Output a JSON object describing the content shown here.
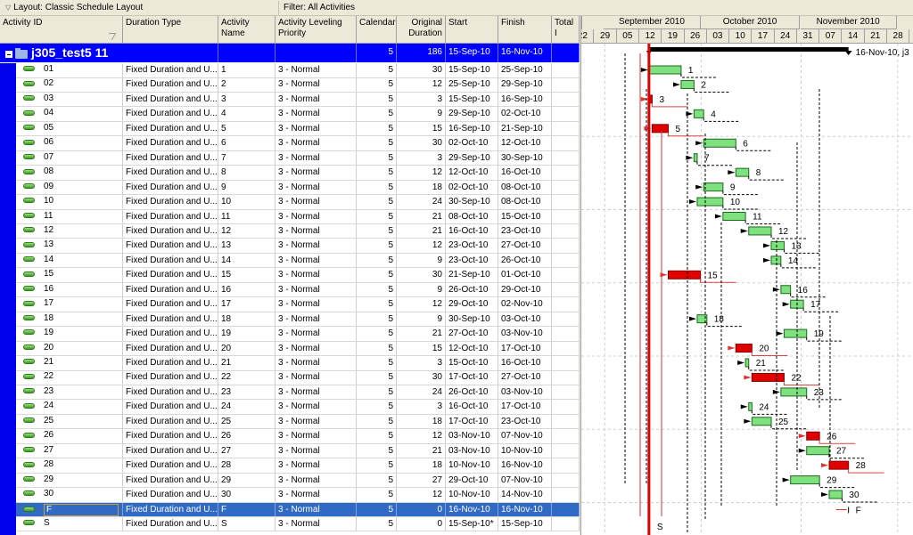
{
  "toolbar": {
    "layout_label": "Layout: Classic Schedule Layout",
    "filter_label": "Filter: All Activities"
  },
  "columns": [
    {
      "key": "id",
      "label": "Activity ID"
    },
    {
      "key": "duration_type",
      "label": "Duration Type"
    },
    {
      "key": "name",
      "label": "Activity Name"
    },
    {
      "key": "priority",
      "label": "Activity Leveling Priority"
    },
    {
      "key": "calendar",
      "label": "Calendar"
    },
    {
      "key": "orig_duration",
      "label": "Original Duration"
    },
    {
      "key": "start",
      "label": "Start"
    },
    {
      "key": "finish",
      "label": "Finish"
    },
    {
      "key": "total_float",
      "label": "Total I"
    }
  ],
  "group": {
    "title": "j305_test5  11",
    "calendar": "5",
    "orig_duration": "186",
    "start": "15-Sep-10",
    "finish": "16-Nov-10"
  },
  "activities": [
    {
      "id": "01",
      "duration_type": "Fixed Duration and U...",
      "name": "1",
      "priority": "3 - Normal",
      "calendar": "5",
      "orig_duration": "30",
      "start": "15-Sep-10",
      "finish": "25-Sep-10",
      "critical": false
    },
    {
      "id": "02",
      "duration_type": "Fixed Duration and U...",
      "name": "2",
      "priority": "3 - Normal",
      "calendar": "5",
      "orig_duration": "12",
      "start": "25-Sep-10",
      "finish": "29-Sep-10",
      "critical": false
    },
    {
      "id": "03",
      "duration_type": "Fixed Duration and U...",
      "name": "3",
      "priority": "3 - Normal",
      "calendar": "5",
      "orig_duration": "3",
      "start": "15-Sep-10",
      "finish": "16-Sep-10",
      "critical": true
    },
    {
      "id": "04",
      "duration_type": "Fixed Duration and U...",
      "name": "4",
      "priority": "3 - Normal",
      "calendar": "5",
      "orig_duration": "9",
      "start": "29-Sep-10",
      "finish": "02-Oct-10",
      "critical": false
    },
    {
      "id": "05",
      "duration_type": "Fixed Duration and U...",
      "name": "5",
      "priority": "3 - Normal",
      "calendar": "5",
      "orig_duration": "15",
      "start": "16-Sep-10",
      "finish": "21-Sep-10",
      "critical": true
    },
    {
      "id": "06",
      "duration_type": "Fixed Duration and U...",
      "name": "6",
      "priority": "3 - Normal",
      "calendar": "5",
      "orig_duration": "30",
      "start": "02-Oct-10",
      "finish": "12-Oct-10",
      "critical": false
    },
    {
      "id": "07",
      "duration_type": "Fixed Duration and U...",
      "name": "7",
      "priority": "3 - Normal",
      "calendar": "5",
      "orig_duration": "3",
      "start": "29-Sep-10",
      "finish": "30-Sep-10",
      "critical": false
    },
    {
      "id": "08",
      "duration_type": "Fixed Duration and U...",
      "name": "8",
      "priority": "3 - Normal",
      "calendar": "5",
      "orig_duration": "12",
      "start": "12-Oct-10",
      "finish": "16-Oct-10",
      "critical": false
    },
    {
      "id": "09",
      "duration_type": "Fixed Duration and U...",
      "name": "9",
      "priority": "3 - Normal",
      "calendar": "5",
      "orig_duration": "18",
      "start": "02-Oct-10",
      "finish": "08-Oct-10",
      "critical": false
    },
    {
      "id": "10",
      "duration_type": "Fixed Duration and U...",
      "name": "10",
      "priority": "3 - Normal",
      "calendar": "5",
      "orig_duration": "24",
      "start": "30-Sep-10",
      "finish": "08-Oct-10",
      "critical": false
    },
    {
      "id": "11",
      "duration_type": "Fixed Duration and U...",
      "name": "11",
      "priority": "3 - Normal",
      "calendar": "5",
      "orig_duration": "21",
      "start": "08-Oct-10",
      "finish": "15-Oct-10",
      "critical": false
    },
    {
      "id": "12",
      "duration_type": "Fixed Duration and U...",
      "name": "12",
      "priority": "3 - Normal",
      "calendar": "5",
      "orig_duration": "21",
      "start": "16-Oct-10",
      "finish": "23-Oct-10",
      "critical": false
    },
    {
      "id": "13",
      "duration_type": "Fixed Duration and U...",
      "name": "13",
      "priority": "3 - Normal",
      "calendar": "5",
      "orig_duration": "12",
      "start": "23-Oct-10",
      "finish": "27-Oct-10",
      "critical": false
    },
    {
      "id": "14",
      "duration_type": "Fixed Duration and U...",
      "name": "14",
      "priority": "3 - Normal",
      "calendar": "5",
      "orig_duration": "9",
      "start": "23-Oct-10",
      "finish": "26-Oct-10",
      "critical": false
    },
    {
      "id": "15",
      "duration_type": "Fixed Duration and U...",
      "name": "15",
      "priority": "3 - Normal",
      "calendar": "5",
      "orig_duration": "30",
      "start": "21-Sep-10",
      "finish": "01-Oct-10",
      "critical": true
    },
    {
      "id": "16",
      "duration_type": "Fixed Duration and U...",
      "name": "16",
      "priority": "3 - Normal",
      "calendar": "5",
      "orig_duration": "9",
      "start": "26-Oct-10",
      "finish": "29-Oct-10",
      "critical": false
    },
    {
      "id": "17",
      "duration_type": "Fixed Duration and U...",
      "name": "17",
      "priority": "3 - Normal",
      "calendar": "5",
      "orig_duration": "12",
      "start": "29-Oct-10",
      "finish": "02-Nov-10",
      "critical": false
    },
    {
      "id": "18",
      "duration_type": "Fixed Duration and U...",
      "name": "18",
      "priority": "3 - Normal",
      "calendar": "5",
      "orig_duration": "9",
      "start": "30-Sep-10",
      "finish": "03-Oct-10",
      "critical": false
    },
    {
      "id": "19",
      "duration_type": "Fixed Duration and U...",
      "name": "19",
      "priority": "3 - Normal",
      "calendar": "5",
      "orig_duration": "21",
      "start": "27-Oct-10",
      "finish": "03-Nov-10",
      "critical": false
    },
    {
      "id": "20",
      "duration_type": "Fixed Duration and U...",
      "name": "20",
      "priority": "3 - Normal",
      "calendar": "5",
      "orig_duration": "15",
      "start": "12-Oct-10",
      "finish": "17-Oct-10",
      "critical": true
    },
    {
      "id": "21",
      "duration_type": "Fixed Duration and U...",
      "name": "21",
      "priority": "3 - Normal",
      "calendar": "5",
      "orig_duration": "3",
      "start": "15-Oct-10",
      "finish": "16-Oct-10",
      "critical": false
    },
    {
      "id": "22",
      "duration_type": "Fixed Duration and U...",
      "name": "22",
      "priority": "3 - Normal",
      "calendar": "5",
      "orig_duration": "30",
      "start": "17-Oct-10",
      "finish": "27-Oct-10",
      "critical": true
    },
    {
      "id": "23",
      "duration_type": "Fixed Duration and U...",
      "name": "23",
      "priority": "3 - Normal",
      "calendar": "5",
      "orig_duration": "24",
      "start": "26-Oct-10",
      "finish": "03-Nov-10",
      "critical": false
    },
    {
      "id": "24",
      "duration_type": "Fixed Duration and U...",
      "name": "24",
      "priority": "3 - Normal",
      "calendar": "5",
      "orig_duration": "3",
      "start": "16-Oct-10",
      "finish": "17-Oct-10",
      "critical": false
    },
    {
      "id": "25",
      "duration_type": "Fixed Duration and U...",
      "name": "25",
      "priority": "3 - Normal",
      "calendar": "5",
      "orig_duration": "18",
      "start": "17-Oct-10",
      "finish": "23-Oct-10",
      "critical": false
    },
    {
      "id": "26",
      "duration_type": "Fixed Duration and U...",
      "name": "26",
      "priority": "3 - Normal",
      "calendar": "5",
      "orig_duration": "12",
      "start": "03-Nov-10",
      "finish": "07-Nov-10",
      "critical": true
    },
    {
      "id": "27",
      "duration_type": "Fixed Duration and U...",
      "name": "27",
      "priority": "3 - Normal",
      "calendar": "5",
      "orig_duration": "21",
      "start": "03-Nov-10",
      "finish": "10-Nov-10",
      "critical": false
    },
    {
      "id": "28",
      "duration_type": "Fixed Duration and U...",
      "name": "28",
      "priority": "3 - Normal",
      "calendar": "5",
      "orig_duration": "18",
      "start": "10-Nov-10",
      "finish": "16-Nov-10",
      "critical": true
    },
    {
      "id": "29",
      "duration_type": "Fixed Duration and U...",
      "name": "29",
      "priority": "3 - Normal",
      "calendar": "5",
      "orig_duration": "27",
      "start": "29-Oct-10",
      "finish": "07-Nov-10",
      "critical": false
    },
    {
      "id": "30",
      "duration_type": "Fixed Duration and U...",
      "name": "30",
      "priority": "3 - Normal",
      "calendar": "5",
      "orig_duration": "12",
      "start": "10-Nov-10",
      "finish": "14-Nov-10",
      "critical": false
    },
    {
      "id": "F",
      "duration_type": "Fixed Duration and U...",
      "name": "F",
      "priority": "3 - Normal",
      "calendar": "5",
      "orig_duration": "0",
      "start": "16-Nov-10",
      "finish": "16-Nov-10",
      "critical": true,
      "selected": true
    },
    {
      "id": "S",
      "duration_type": "Fixed Duration and U...",
      "name": "S",
      "priority": "3 - Normal",
      "calendar": "5",
      "orig_duration": "0",
      "start": "15-Sep-10*",
      "finish": "15-Sep-10",
      "critical": false
    }
  ],
  "gantt": {
    "months": [
      "September 2010",
      "October 2010",
      "November 2010"
    ],
    "weeks": [
      "22",
      "29",
      "05",
      "12",
      "19",
      "26",
      "03",
      "10",
      "17",
      "24",
      "31",
      "07",
      "14",
      "21",
      "28"
    ],
    "summary_label": "16-Nov-10, j3",
    "data_date": "15-Sep-10",
    "colors": {
      "normal": "#7fe07f",
      "critical": "#e00000",
      "data_date": "#e00000",
      "group_band": "#0000ff",
      "selected": "#316ac5"
    }
  }
}
